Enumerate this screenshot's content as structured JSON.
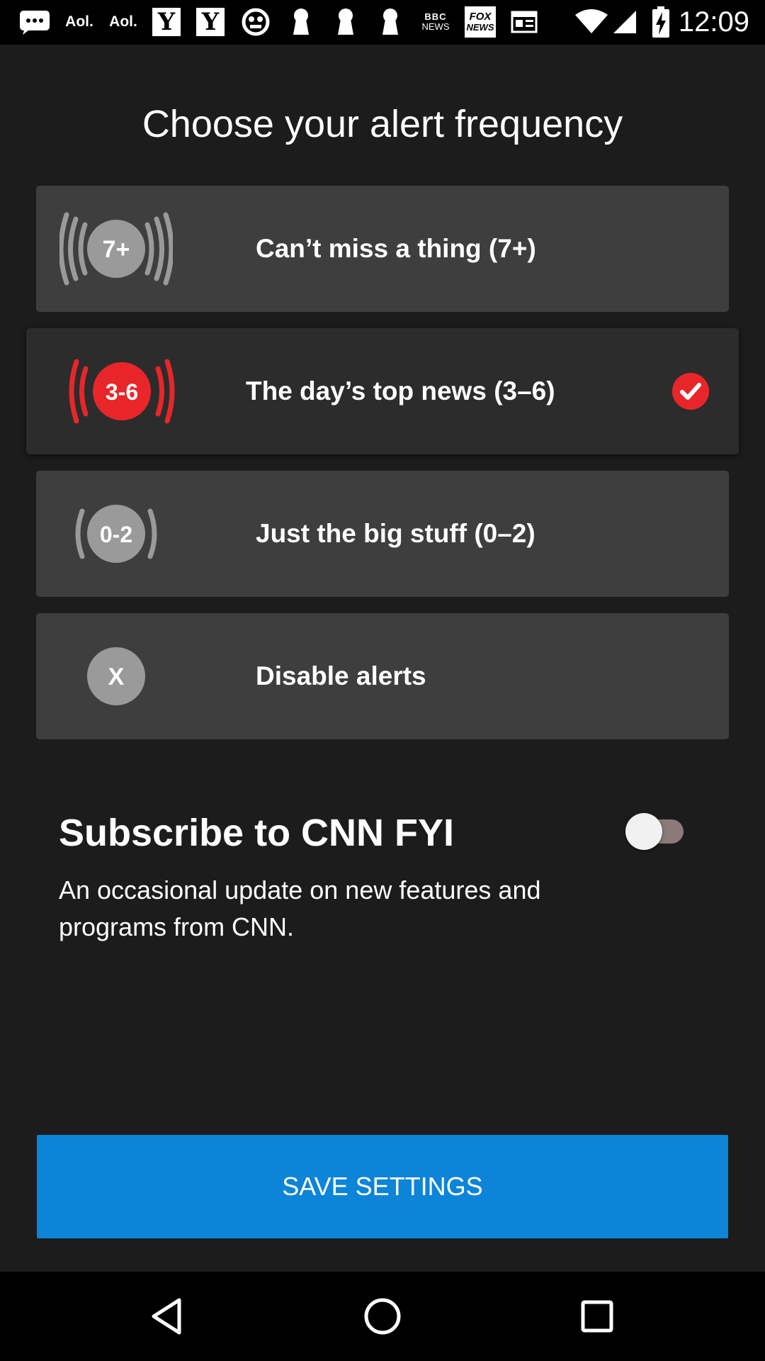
{
  "status_bar": {
    "time": "12:09",
    "icons": [
      {
        "name": "messages-icon"
      },
      {
        "name": "aol-icon",
        "text": "Aol."
      },
      {
        "name": "aol-icon",
        "text": "Aol."
      },
      {
        "name": "yahoo-icon",
        "text": "Y"
      },
      {
        "name": "yahoo-icon",
        "text": "Y"
      },
      {
        "name": "news-app-icon"
      },
      {
        "name": "keyhole-icon"
      },
      {
        "name": "keyhole-icon"
      },
      {
        "name": "keyhole-icon"
      },
      {
        "name": "bbc-news-icon",
        "text": "BBC NEWS"
      },
      {
        "name": "fox-news-icon",
        "text": "FOX NEWS"
      },
      {
        "name": "newspaper-icon"
      },
      {
        "name": "wifi-icon"
      },
      {
        "name": "cell-signal-icon"
      },
      {
        "name": "battery-charging-icon"
      }
    ],
    "aol_label": "Aol.",
    "yahoo_label": "Y",
    "bbc_line1": "BBC",
    "bbc_line2": "NEWS",
    "fox_line1": "FOX",
    "fox_line2": "NEWS"
  },
  "heading": "Choose your alert frequency",
  "options": [
    {
      "badge": "7+",
      "label": "Can’t miss a thing (7+)",
      "selected": false
    },
    {
      "badge": "3-6",
      "label": "The day’s top news (3–6)",
      "selected": true
    },
    {
      "badge": "0-2",
      "label": "Just the big stuff (0–2)",
      "selected": false
    },
    {
      "badge": "X",
      "label": "Disable alerts",
      "selected": false
    }
  ],
  "fyi": {
    "title": "Subscribe to CNN FYI",
    "description": "An occasional update on new features and programs from CNN.",
    "enabled": false
  },
  "save_button": "SAVE SETTINGS",
  "colors": {
    "accent_red": "#e8262a",
    "button_blue": "#0c84d8",
    "option_bg": "#3e3e3e",
    "selected_bg": "#2c2c2c",
    "badge_gray": "#9a9a9a"
  },
  "nav": {
    "back": "back-icon",
    "home": "home-icon",
    "recents": "recents-icon"
  }
}
